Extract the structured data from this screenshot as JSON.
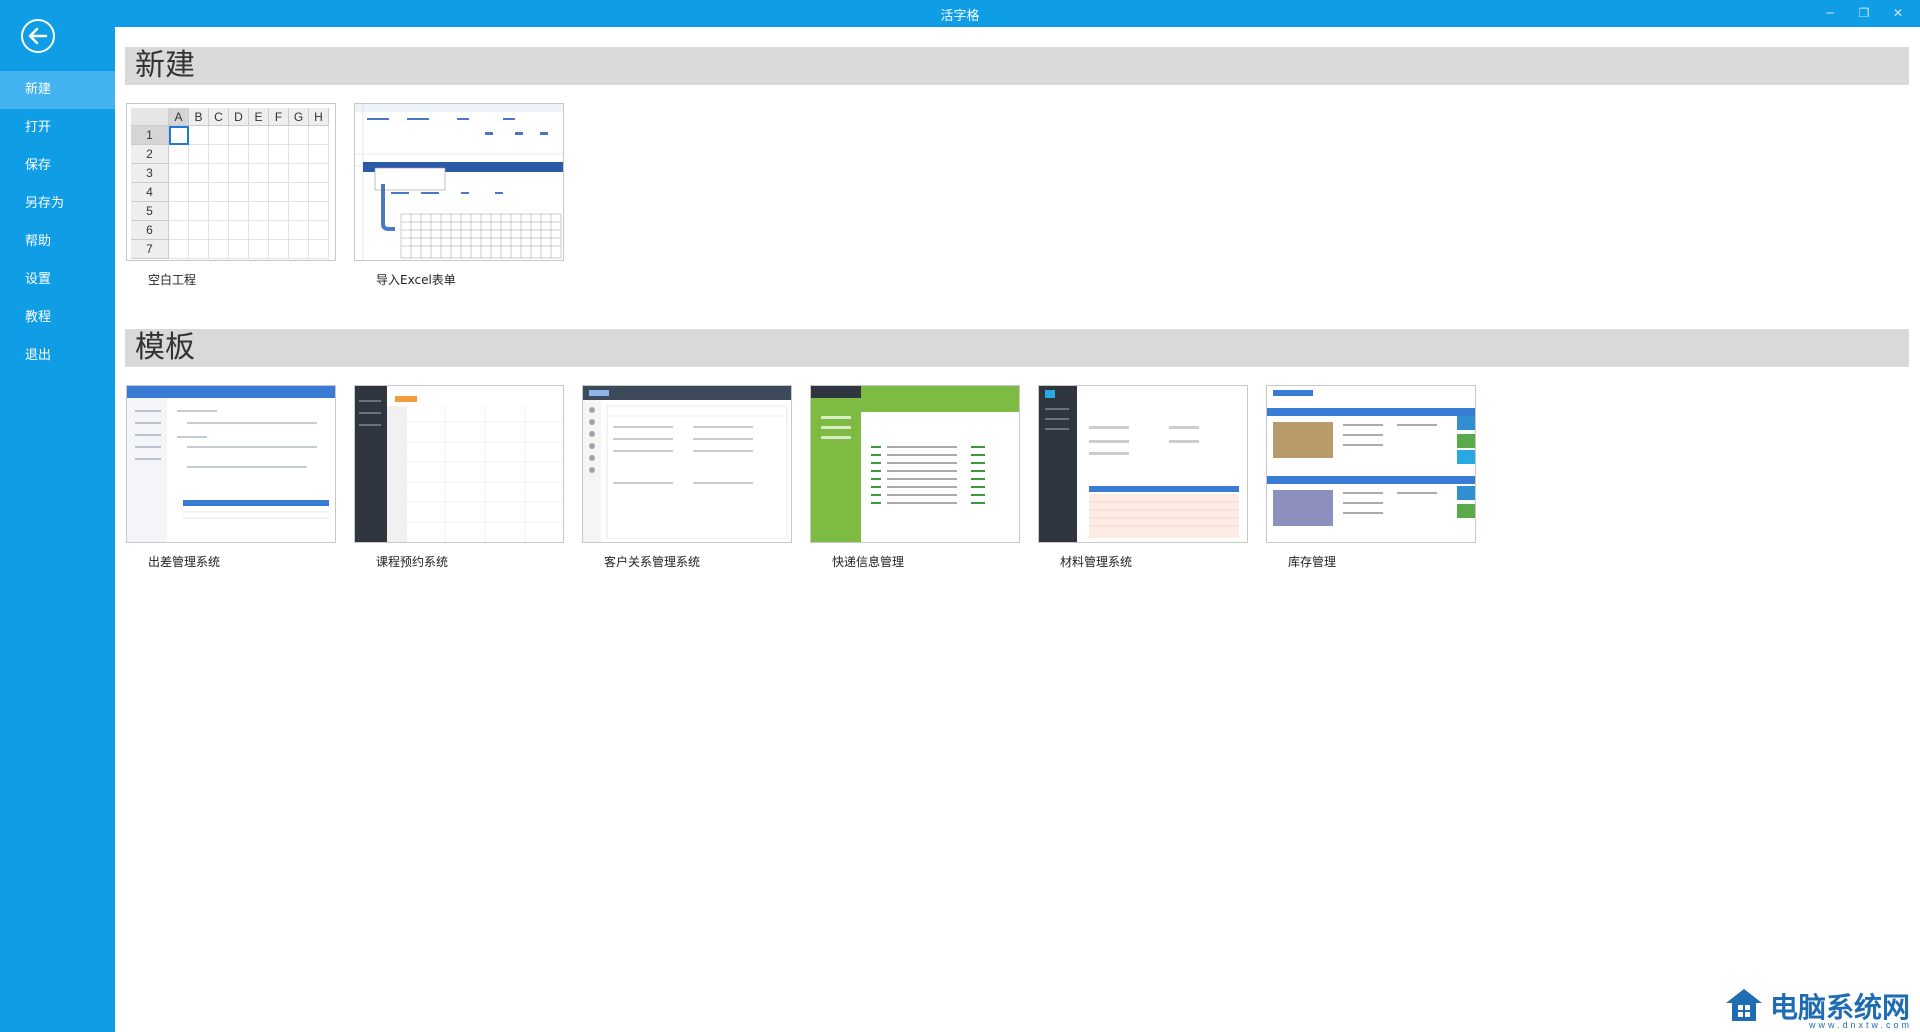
{
  "window": {
    "title": "活字格"
  },
  "sidebar": {
    "items": [
      {
        "label": "新建",
        "active": true
      },
      {
        "label": "打开"
      },
      {
        "label": "保存"
      },
      {
        "label": "另存为"
      },
      {
        "label": "帮助"
      },
      {
        "label": "设置"
      },
      {
        "label": "教程"
      },
      {
        "label": "退出"
      }
    ]
  },
  "sections": {
    "new": {
      "title": "新建",
      "cards": [
        {
          "label": "空白工程"
        },
        {
          "label": "导入Excel表单"
        }
      ]
    },
    "templates": {
      "title": "模板",
      "cards": [
        {
          "label": "出差管理系统"
        },
        {
          "label": "课程预约系统"
        },
        {
          "label": "客户关系管理系统"
        },
        {
          "label": "快递信息管理"
        },
        {
          "label": "材料管理系统"
        },
        {
          "label": "库存管理"
        }
      ]
    }
  },
  "blank_grid": {
    "columns": [
      "A",
      "B",
      "C",
      "D",
      "E",
      "F",
      "G",
      "H"
    ],
    "rows": [
      "1",
      "2",
      "3",
      "4",
      "5",
      "6",
      "7"
    ]
  },
  "watermark": {
    "text": "电脑系统网",
    "sub": "www.dnxtw.com"
  },
  "colors": {
    "accent": "#0f9ee6",
    "active": "#41b3ee",
    "header_bg": "#d9d9d9"
  }
}
